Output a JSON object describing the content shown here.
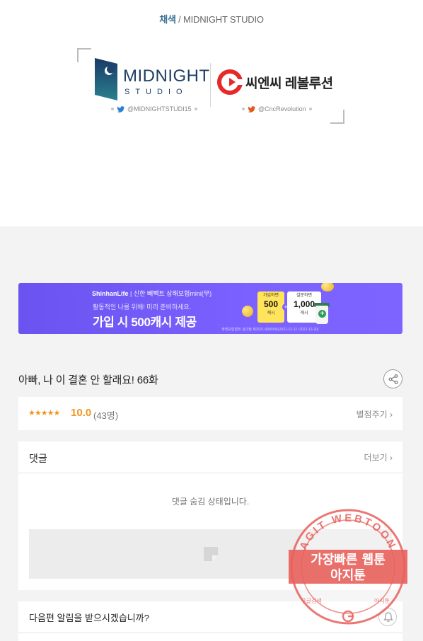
{
  "credit": {
    "role": "채색",
    "separator": "/",
    "studio": "MIDNIGHT STUDIO"
  },
  "partners": {
    "midnight": {
      "word": "MIDNIGHT",
      "sub": "STUDIO",
      "handle": "@MIDNIGHTSTUDI15"
    },
    "cnc": {
      "word": "씨엔씨 레볼루션",
      "handle": "@CncRevolution"
    }
  },
  "ad": {
    "brand": "ShinhanLife",
    "brand_sub": "| 신한 빼빽트 상해보험mini(무)",
    "line1": "활동적인 나를 위해! 미리 준비하세요.",
    "line2": "가입 시 500캐시 제공",
    "box1_top": "가입하면",
    "box1_value": "500",
    "box1_unit": "캐시",
    "box2_top": "설문하면",
    "box2_value": "1,000",
    "box2_unit": "캐시",
    "note": "생명보험협회 심의필 제2021-00000호(2021-12-21~2022-12-20)"
  },
  "episode": {
    "title": "아빠, 나 이 결혼 안 할래요! 66화"
  },
  "rating": {
    "stars": "★★★★★",
    "score": "10.0",
    "count": "(43명)",
    "rate_link": "별점주기 ›"
  },
  "comments": {
    "title": "댓글",
    "more": "더보기 ›",
    "hidden_msg": "댓글 숨김 상태입니다."
  },
  "notify": {
    "title": "다음편 알림을 받으시겠습니까?"
  },
  "watermark": {
    "arc": "AGIT WEBTOON",
    "line1": "가장빠른 웹툰",
    "line2": "아지툰",
    "left_small": "구글검색",
    "right_small": "아지툰"
  },
  "colors": {
    "ad_bg": "#7b61ff",
    "accent_orange": "#f0961d",
    "stamp_red": "#e8605c",
    "midnight_navy": "#1d3f62",
    "cnc_red": "#e52a2a"
  }
}
